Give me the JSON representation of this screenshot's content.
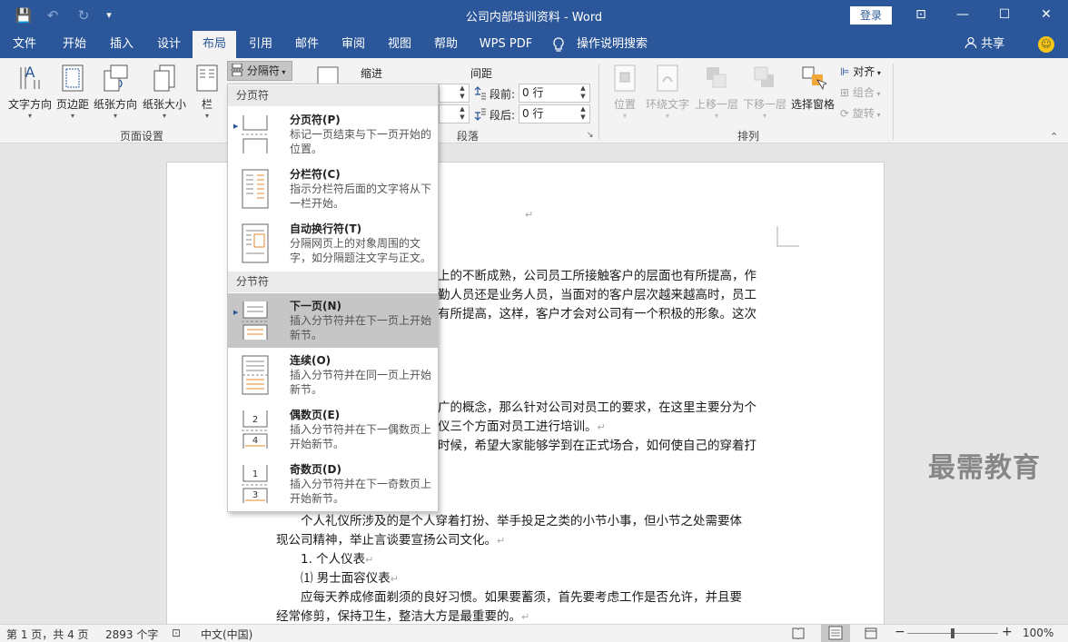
{
  "titlebar": {
    "title": "公司内部培训资料 - Word",
    "login": "登录",
    "save_glyph": "💾",
    "undo_glyph": "↶",
    "redo_glyph": "↻",
    "customize_glyph": "▾",
    "ribbon_display_glyph": "⊡",
    "minimize_glyph": "—",
    "maximize_glyph": "☐",
    "close_glyph": "✕",
    "brand_color": "#2b579a"
  },
  "tabs": [
    "文件",
    "开始",
    "插入",
    "设计",
    "布局",
    "引用",
    "邮件",
    "审阅",
    "视图",
    "帮助",
    "WPS PDF",
    "操作说明搜索"
  ],
  "active_tab": "布局",
  "share": "共享",
  "ribbon": {
    "page_setup": {
      "buttons": [
        "文字方向",
        "页边距",
        "纸张方向",
        "纸张大小",
        "栏"
      ],
      "breaks_button": "分隔符",
      "group_label": "页面设置"
    },
    "paragraph": {
      "indent_label": "缩进",
      "spacing_label": "间距",
      "before_label": "段前:",
      "after_label": "段后:",
      "before_value": "0 行",
      "after_value": "0 行",
      "group_label": "段落",
      "launcher_glyph": "↘"
    },
    "arrange": {
      "buttons": [
        "位置",
        "环绕文字",
        "上移一层",
        "下移一层",
        "选择窗格"
      ],
      "align": "对齐",
      "group": "组合",
      "rotate": "旋转",
      "group_label": "排列",
      "collapse_glyph": "⌃"
    }
  },
  "breaks_menu": {
    "section_page": "分页符",
    "section_section": "分节符",
    "items": [
      {
        "title": "分页符(P)",
        "desc": "标记一页结束与下一页开始的位置。"
      },
      {
        "title": "分栏符(C)",
        "desc": "指示分栏符后面的文字将从下一栏开始。"
      },
      {
        "title": "自动换行符(T)",
        "desc": "分隔网页上的对象周围的文字，如分隔题注文字与正文。"
      },
      {
        "title": "下一页(N)",
        "desc": "插入分节符并在下一页上开始新节。"
      },
      {
        "title": "连续(O)",
        "desc": "插入分节符并在同一页上开始新节。"
      },
      {
        "title": "偶数页(E)",
        "desc": "插入分节符并在下一偶数页上开始新节。"
      },
      {
        "title": "奇数页(D)",
        "desc": "插入分节符并在下一奇数页上开始新节。"
      }
    ],
    "selected_index": 3,
    "icon_numbers": {
      "even": [
        "2",
        "4"
      ],
      "odd": [
        "1",
        "3"
      ]
    }
  },
  "document": {
    "mark": "↵",
    "lines": [
      "上的不断成熟，公司员工所接触客户的层面也有所提高，作",
      "勤人员还是业务人员，当面对的客户层次越来越高时，员工",
      "有所提高，这样，客户才会对公司有一个积极的形象。这次",
      "广的概念，那么针对公司对员工的要求，在这里主要分为个",
      "仪三个方面对员工进行培训。",
      "时候，希望大家能够学到在正式场合，如何使自己的穿着打",
      "个人礼仪所涉及的是个人穿着打扮、举手投足之类的小节小事，但小节之处需要体",
      "现公司精神，举止言谈要宣扬公司文化。",
      "1.   个人仪表",
      "⑴ 男士面容仪表",
      "应每天养成修面剃须的良好习惯。如果要蓄须，首先要考虑工作是否允许，并且要",
      "经常修剪，保持卫生，整洁大方是最重要的。"
    ]
  },
  "watermark": "最需教育",
  "statusbar": {
    "page": "第 1 页，共 4 页",
    "words": "2893 个字",
    "proof_glyph": "⊡",
    "language": "中文(中国)",
    "zoom_out": "−",
    "zoom_in": "+",
    "zoom": "100%",
    "zoom_level": 1.0
  }
}
